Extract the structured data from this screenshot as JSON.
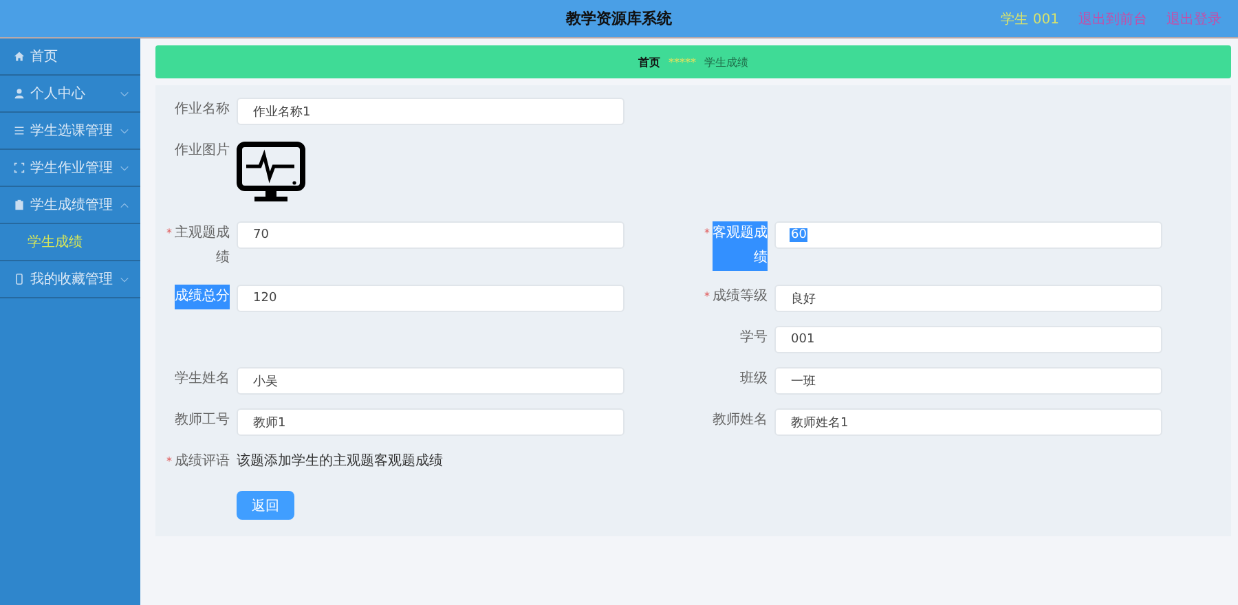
{
  "header": {
    "title": "教学资源库系统",
    "user": "学生 001",
    "links": [
      "退出到前台",
      "退出登录"
    ]
  },
  "sidebar": {
    "items": [
      {
        "label": "首页",
        "has_arrow": false
      },
      {
        "label": "个人中心",
        "expanded": false,
        "has_arrow": true
      },
      {
        "label": "学生选课管理",
        "expanded": false,
        "has_arrow": true
      },
      {
        "label": "学生作业管理",
        "expanded": false,
        "has_arrow": true
      },
      {
        "label": "学生成绩管理",
        "expanded": true,
        "has_arrow": true,
        "children": [
          {
            "label": "学生成绩",
            "selected": true
          }
        ]
      },
      {
        "label": "我的收藏管理",
        "expanded": false,
        "has_arrow": true
      }
    ]
  },
  "breadcrumb": {
    "home": "首页",
    "separator": "*****",
    "current": "学生成绩"
  },
  "form": {
    "rows": [
      {
        "left": {
          "label": "作业名称",
          "kind": "input",
          "value": "作业名称1",
          "label_highlighted": false,
          "value_highlighted": false
        }
      },
      {
        "left": {
          "label": "作业图片",
          "kind": "image",
          "label_highlighted": false
        }
      },
      {
        "left": {
          "label": "主观题成绩",
          "kind": "input",
          "value": "70",
          "required_mark": "*",
          "label_highlighted": false,
          "value_highlighted": false
        },
        "right": {
          "label": "客观题成绩",
          "kind": "input",
          "value": "60",
          "required_mark": "*",
          "label_highlighted": true,
          "value_highlighted": true
        }
      },
      {
        "left": {
          "label": "成绩总分",
          "kind": "input",
          "value": "120",
          "label_highlighted": true,
          "value_highlighted": false
        },
        "right": {
          "label": "成绩等级",
          "kind": "input",
          "value": "良好",
          "required_mark": "*",
          "label_highlighted": false,
          "value_highlighted": false
        }
      },
      {
        "right": {
          "label": "学号",
          "kind": "input",
          "value": "001",
          "label_highlighted": false,
          "value_highlighted": false
        }
      },
      {
        "left": {
          "label": "学生姓名",
          "kind": "input",
          "value": "小吴",
          "label_highlighted": false,
          "value_highlighted": false
        },
        "right": {
          "label": "班级",
          "kind": "input",
          "value": "一班",
          "label_highlighted": false,
          "value_highlighted": false
        }
      },
      {
        "left": {
          "label": "教师工号",
          "kind": "input",
          "value": "教师1",
          "label_highlighted": false,
          "value_highlighted": false
        },
        "right": {
          "label": "教师姓名",
          "kind": "input",
          "value": "教师姓名1",
          "label_highlighted": false,
          "value_highlighted": false
        }
      },
      {
        "full": {
          "label": "成绩评语",
          "kind": "text",
          "value": "该题添加学生的主观题客观题成绩",
          "required_mark": "*",
          "label_highlighted": false
        }
      }
    ],
    "button": "返回"
  }
}
